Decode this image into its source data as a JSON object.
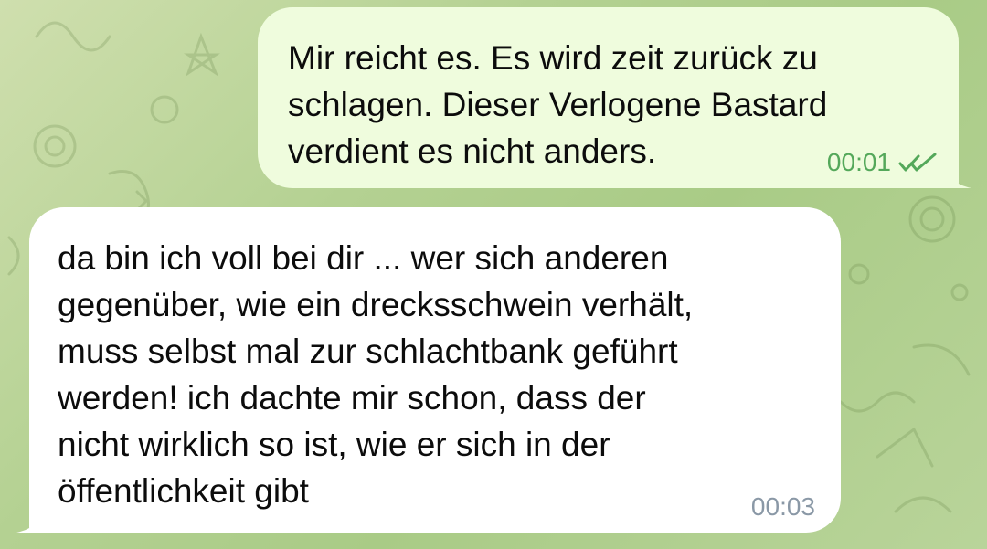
{
  "chat": {
    "messages": [
      {
        "direction": "outgoing",
        "text": "Mir reicht es. Es wird zeit zurück zu\nschlagen. Dieser Verlogene Bastard\nverdient es nicht anders.",
        "time": "00:01",
        "status_icon": "double-check-icon"
      },
      {
        "direction": "incoming",
        "text": "da bin ich voll bei dir ... wer sich anderen\ngegenüber, wie ein drecksschwein verhält,\nmuss selbst mal zur schlachtbank geführt\nwerden! ich dachte mir schon, dass der\nnicht wirklich so ist, wie er sich in der\nöffentlichkeit gibt",
        "time": "00:03"
      }
    ]
  },
  "colors": {
    "outgoing_bubble": "#effcdd",
    "incoming_bubble": "#ffffff",
    "outgoing_meta": "#54a85a",
    "incoming_meta": "#8a98a6",
    "wallpaper": "#b4d192"
  }
}
